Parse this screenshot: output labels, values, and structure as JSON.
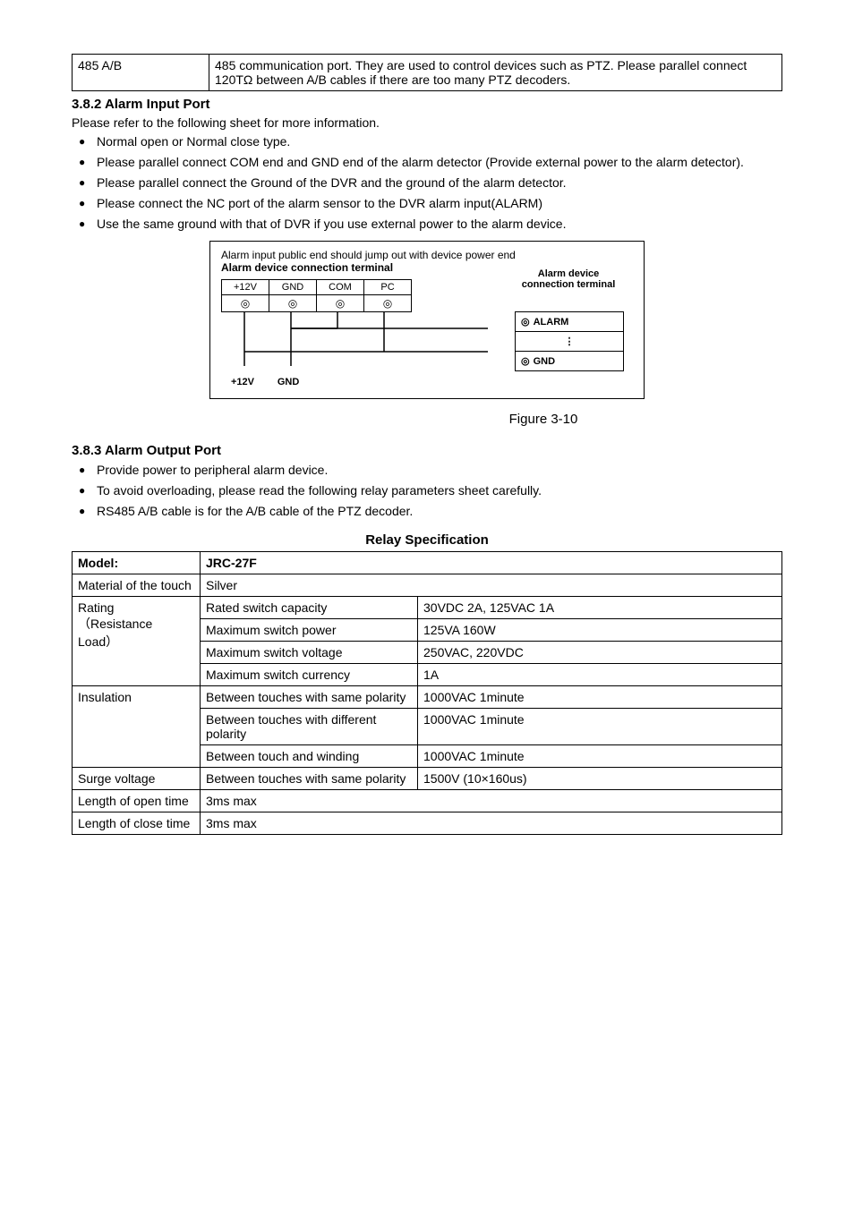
{
  "top_table": {
    "c1": "485 A/B",
    "c2": "485 communication port. They are used to control devices such as PTZ. Please parallel connect 120TΩ between A/B cables if there are too many PTZ decoders."
  },
  "sec382": {
    "heading": "3.8.2  Alarm Input Port",
    "intro": "Please refer to the following sheet for more information.",
    "bullets": [
      "Normal open or Normal close type.",
      "Please parallel connect COM end and GND end of the alarm detector (Provide external power to the alarm detector).",
      "Please parallel connect the Ground of the DVR and the ground of the alarm detector.",
      "Please connect the NC port of the alarm sensor to the DVR alarm input(ALARM)",
      "Use the same ground with that of DVR if you use external power to the alarm device."
    ]
  },
  "diagram": {
    "top1": "Alarm input public end should jump out with device power end",
    "top2": "Alarm device connection terminal",
    "headers": [
      "+12V",
      "GND",
      "COM",
      "PC"
    ],
    "dev_label1": "Alarm device",
    "dev_label2": "connection terminal",
    "box_alarm": "ALARM",
    "box_dots": "⋮",
    "box_gnd": "GND",
    "bottom_l": "+12V",
    "bottom_r": "GND"
  },
  "figure_caption": "Figure 3-10",
  "sec383": {
    "heading": "3.8.3  Alarm Output Port",
    "bullets": [
      "Provide power to peripheral alarm device.",
      "To avoid overloading, please read the following relay parameters sheet carefully.",
      "RS485 A/B cable is for the A/B cable of the PTZ decoder."
    ]
  },
  "relay_heading": "Relay Specification",
  "relay": {
    "rows": {
      "model_l": "Model:",
      "model_v": "JRC-27F",
      "material_l": "Material of the touch",
      "material_v": "Silver",
      "rating_l": "Rating\n（Resistance\nLoad）",
      "r1a": "Rated switch capacity",
      "r1b": "30VDC 2A, 125VAC 1A",
      "r2a": "Maximum switch power",
      "r2b": "125VA 160W",
      "r3a": "Maximum switch voltage",
      "r3b": "250VAC, 220VDC",
      "r4a": "Maximum switch currency",
      "r4b": "1A",
      "ins_l": "Insulation",
      "i1a": "Between touches with same polarity",
      "i1b": "1000VAC 1minute",
      "i2a": "Between touches with different polarity",
      "i2b": "1000VAC 1minute",
      "i3a": "Between touch and winding",
      "i3b": "1000VAC 1minute",
      "surge_l": "Surge voltage",
      "s1a": "Between touches with same polarity",
      "s1b": "1500V (10×160us)",
      "open_l": "Length of open time",
      "open_v": "3ms max",
      "close_l": "Length of close time",
      "close_v": "3ms max"
    }
  }
}
